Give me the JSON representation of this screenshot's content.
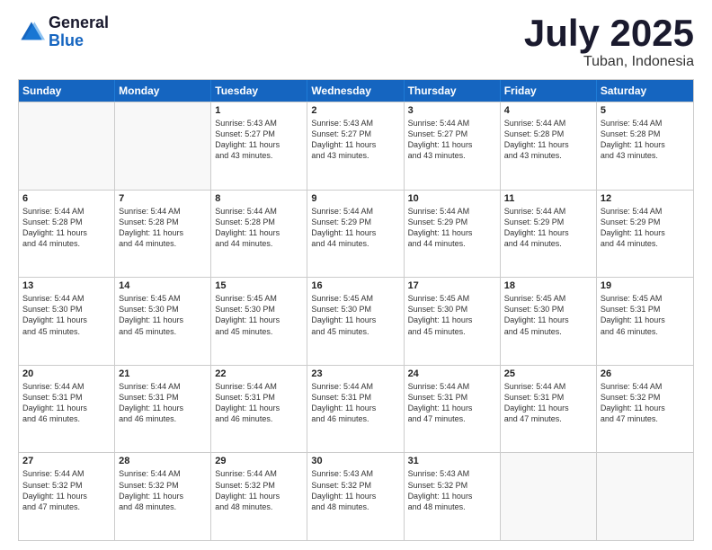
{
  "logo": {
    "general": "General",
    "blue": "Blue"
  },
  "title": {
    "month": "July 2025",
    "location": "Tuban, Indonesia"
  },
  "calendar": {
    "headers": [
      "Sunday",
      "Monday",
      "Tuesday",
      "Wednesday",
      "Thursday",
      "Friday",
      "Saturday"
    ],
    "rows": [
      [
        {
          "day": "",
          "lines": []
        },
        {
          "day": "",
          "lines": []
        },
        {
          "day": "1",
          "lines": [
            "Sunrise: 5:43 AM",
            "Sunset: 5:27 PM",
            "Daylight: 11 hours",
            "and 43 minutes."
          ]
        },
        {
          "day": "2",
          "lines": [
            "Sunrise: 5:43 AM",
            "Sunset: 5:27 PM",
            "Daylight: 11 hours",
            "and 43 minutes."
          ]
        },
        {
          "day": "3",
          "lines": [
            "Sunrise: 5:44 AM",
            "Sunset: 5:27 PM",
            "Daylight: 11 hours",
            "and 43 minutes."
          ]
        },
        {
          "day": "4",
          "lines": [
            "Sunrise: 5:44 AM",
            "Sunset: 5:28 PM",
            "Daylight: 11 hours",
            "and 43 minutes."
          ]
        },
        {
          "day": "5",
          "lines": [
            "Sunrise: 5:44 AM",
            "Sunset: 5:28 PM",
            "Daylight: 11 hours",
            "and 43 minutes."
          ]
        }
      ],
      [
        {
          "day": "6",
          "lines": [
            "Sunrise: 5:44 AM",
            "Sunset: 5:28 PM",
            "Daylight: 11 hours",
            "and 44 minutes."
          ]
        },
        {
          "day": "7",
          "lines": [
            "Sunrise: 5:44 AM",
            "Sunset: 5:28 PM",
            "Daylight: 11 hours",
            "and 44 minutes."
          ]
        },
        {
          "day": "8",
          "lines": [
            "Sunrise: 5:44 AM",
            "Sunset: 5:28 PM",
            "Daylight: 11 hours",
            "and 44 minutes."
          ]
        },
        {
          "day": "9",
          "lines": [
            "Sunrise: 5:44 AM",
            "Sunset: 5:29 PM",
            "Daylight: 11 hours",
            "and 44 minutes."
          ]
        },
        {
          "day": "10",
          "lines": [
            "Sunrise: 5:44 AM",
            "Sunset: 5:29 PM",
            "Daylight: 11 hours",
            "and 44 minutes."
          ]
        },
        {
          "day": "11",
          "lines": [
            "Sunrise: 5:44 AM",
            "Sunset: 5:29 PM",
            "Daylight: 11 hours",
            "and 44 minutes."
          ]
        },
        {
          "day": "12",
          "lines": [
            "Sunrise: 5:44 AM",
            "Sunset: 5:29 PM",
            "Daylight: 11 hours",
            "and 44 minutes."
          ]
        }
      ],
      [
        {
          "day": "13",
          "lines": [
            "Sunrise: 5:44 AM",
            "Sunset: 5:30 PM",
            "Daylight: 11 hours",
            "and 45 minutes."
          ]
        },
        {
          "day": "14",
          "lines": [
            "Sunrise: 5:45 AM",
            "Sunset: 5:30 PM",
            "Daylight: 11 hours",
            "and 45 minutes."
          ]
        },
        {
          "day": "15",
          "lines": [
            "Sunrise: 5:45 AM",
            "Sunset: 5:30 PM",
            "Daylight: 11 hours",
            "and 45 minutes."
          ]
        },
        {
          "day": "16",
          "lines": [
            "Sunrise: 5:45 AM",
            "Sunset: 5:30 PM",
            "Daylight: 11 hours",
            "and 45 minutes."
          ]
        },
        {
          "day": "17",
          "lines": [
            "Sunrise: 5:45 AM",
            "Sunset: 5:30 PM",
            "Daylight: 11 hours",
            "and 45 minutes."
          ]
        },
        {
          "day": "18",
          "lines": [
            "Sunrise: 5:45 AM",
            "Sunset: 5:30 PM",
            "Daylight: 11 hours",
            "and 45 minutes."
          ]
        },
        {
          "day": "19",
          "lines": [
            "Sunrise: 5:45 AM",
            "Sunset: 5:31 PM",
            "Daylight: 11 hours",
            "and 46 minutes."
          ]
        }
      ],
      [
        {
          "day": "20",
          "lines": [
            "Sunrise: 5:44 AM",
            "Sunset: 5:31 PM",
            "Daylight: 11 hours",
            "and 46 minutes."
          ]
        },
        {
          "day": "21",
          "lines": [
            "Sunrise: 5:44 AM",
            "Sunset: 5:31 PM",
            "Daylight: 11 hours",
            "and 46 minutes."
          ]
        },
        {
          "day": "22",
          "lines": [
            "Sunrise: 5:44 AM",
            "Sunset: 5:31 PM",
            "Daylight: 11 hours",
            "and 46 minutes."
          ]
        },
        {
          "day": "23",
          "lines": [
            "Sunrise: 5:44 AM",
            "Sunset: 5:31 PM",
            "Daylight: 11 hours",
            "and 46 minutes."
          ]
        },
        {
          "day": "24",
          "lines": [
            "Sunrise: 5:44 AM",
            "Sunset: 5:31 PM",
            "Daylight: 11 hours",
            "and 47 minutes."
          ]
        },
        {
          "day": "25",
          "lines": [
            "Sunrise: 5:44 AM",
            "Sunset: 5:31 PM",
            "Daylight: 11 hours",
            "and 47 minutes."
          ]
        },
        {
          "day": "26",
          "lines": [
            "Sunrise: 5:44 AM",
            "Sunset: 5:32 PM",
            "Daylight: 11 hours",
            "and 47 minutes."
          ]
        }
      ],
      [
        {
          "day": "27",
          "lines": [
            "Sunrise: 5:44 AM",
            "Sunset: 5:32 PM",
            "Daylight: 11 hours",
            "and 47 minutes."
          ]
        },
        {
          "day": "28",
          "lines": [
            "Sunrise: 5:44 AM",
            "Sunset: 5:32 PM",
            "Daylight: 11 hours",
            "and 48 minutes."
          ]
        },
        {
          "day": "29",
          "lines": [
            "Sunrise: 5:44 AM",
            "Sunset: 5:32 PM",
            "Daylight: 11 hours",
            "and 48 minutes."
          ]
        },
        {
          "day": "30",
          "lines": [
            "Sunrise: 5:43 AM",
            "Sunset: 5:32 PM",
            "Daylight: 11 hours",
            "and 48 minutes."
          ]
        },
        {
          "day": "31",
          "lines": [
            "Sunrise: 5:43 AM",
            "Sunset: 5:32 PM",
            "Daylight: 11 hours",
            "and 48 minutes."
          ]
        },
        {
          "day": "",
          "lines": []
        },
        {
          "day": "",
          "lines": []
        }
      ]
    ]
  }
}
